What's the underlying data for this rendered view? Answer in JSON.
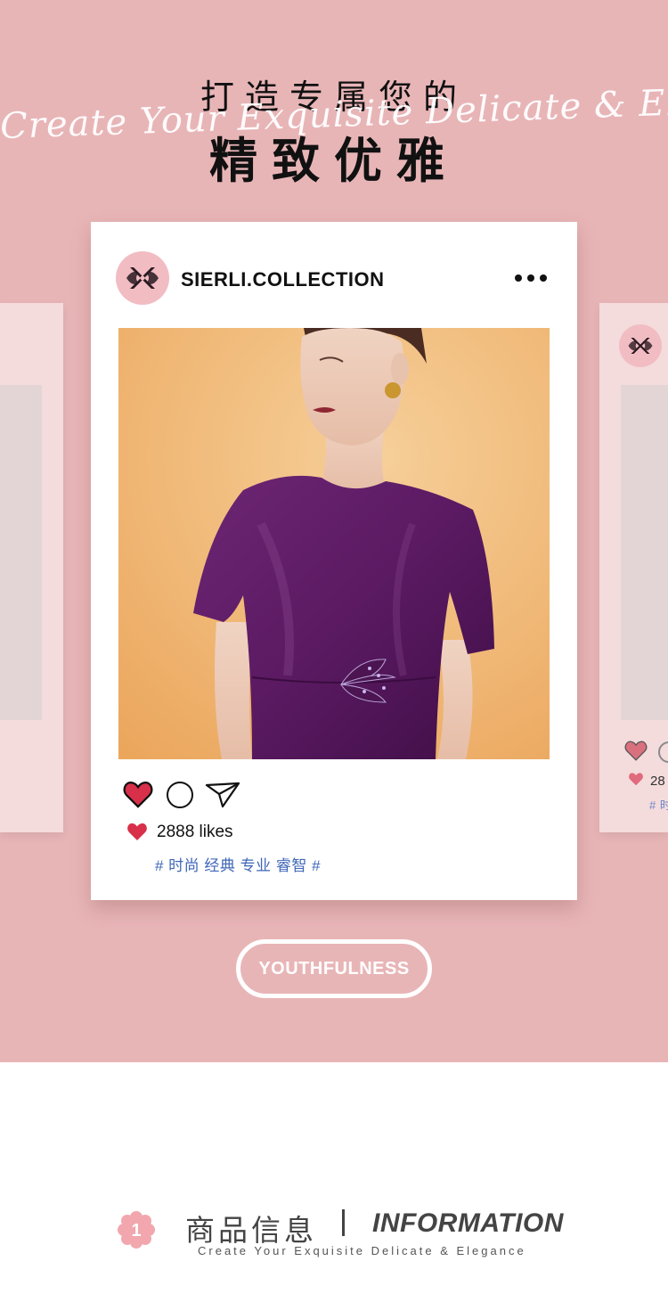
{
  "hero": {
    "title_line1": "打造专属您的",
    "script_text": "Create Your Exquisite Delicate & Elegance",
    "title_line2": "精致优雅",
    "background_color": "#e8b5b7"
  },
  "post": {
    "username": "SIERLI.COLLECTION",
    "more_icon": "more-dots-icon",
    "avatar_icon": "brand-logo",
    "photo_alt": "model in purple satin dress",
    "actions": {
      "like_icon": "heart-filled-icon",
      "comment_icon": "comment-circle-icon",
      "share_icon": "send-plane-icon"
    },
    "likes_text": "2888 likes",
    "tags_text": "# 时尚 经典 专业 睿智 #",
    "like_color": "#d8304a",
    "tag_color": "#3f66b8"
  },
  "ghost_card_right": {
    "likes_text": "28",
    "tags_text": "# 时"
  },
  "badge": {
    "label": "YOUTHFULNESS"
  },
  "info_section": {
    "number": "1",
    "title_cn": "商品信息",
    "divider": "|",
    "title_en": "INFORMATION",
    "subtitle": "Create Your Exquisite Delicate & Elegance",
    "accent_color": "#f2a7ae"
  }
}
